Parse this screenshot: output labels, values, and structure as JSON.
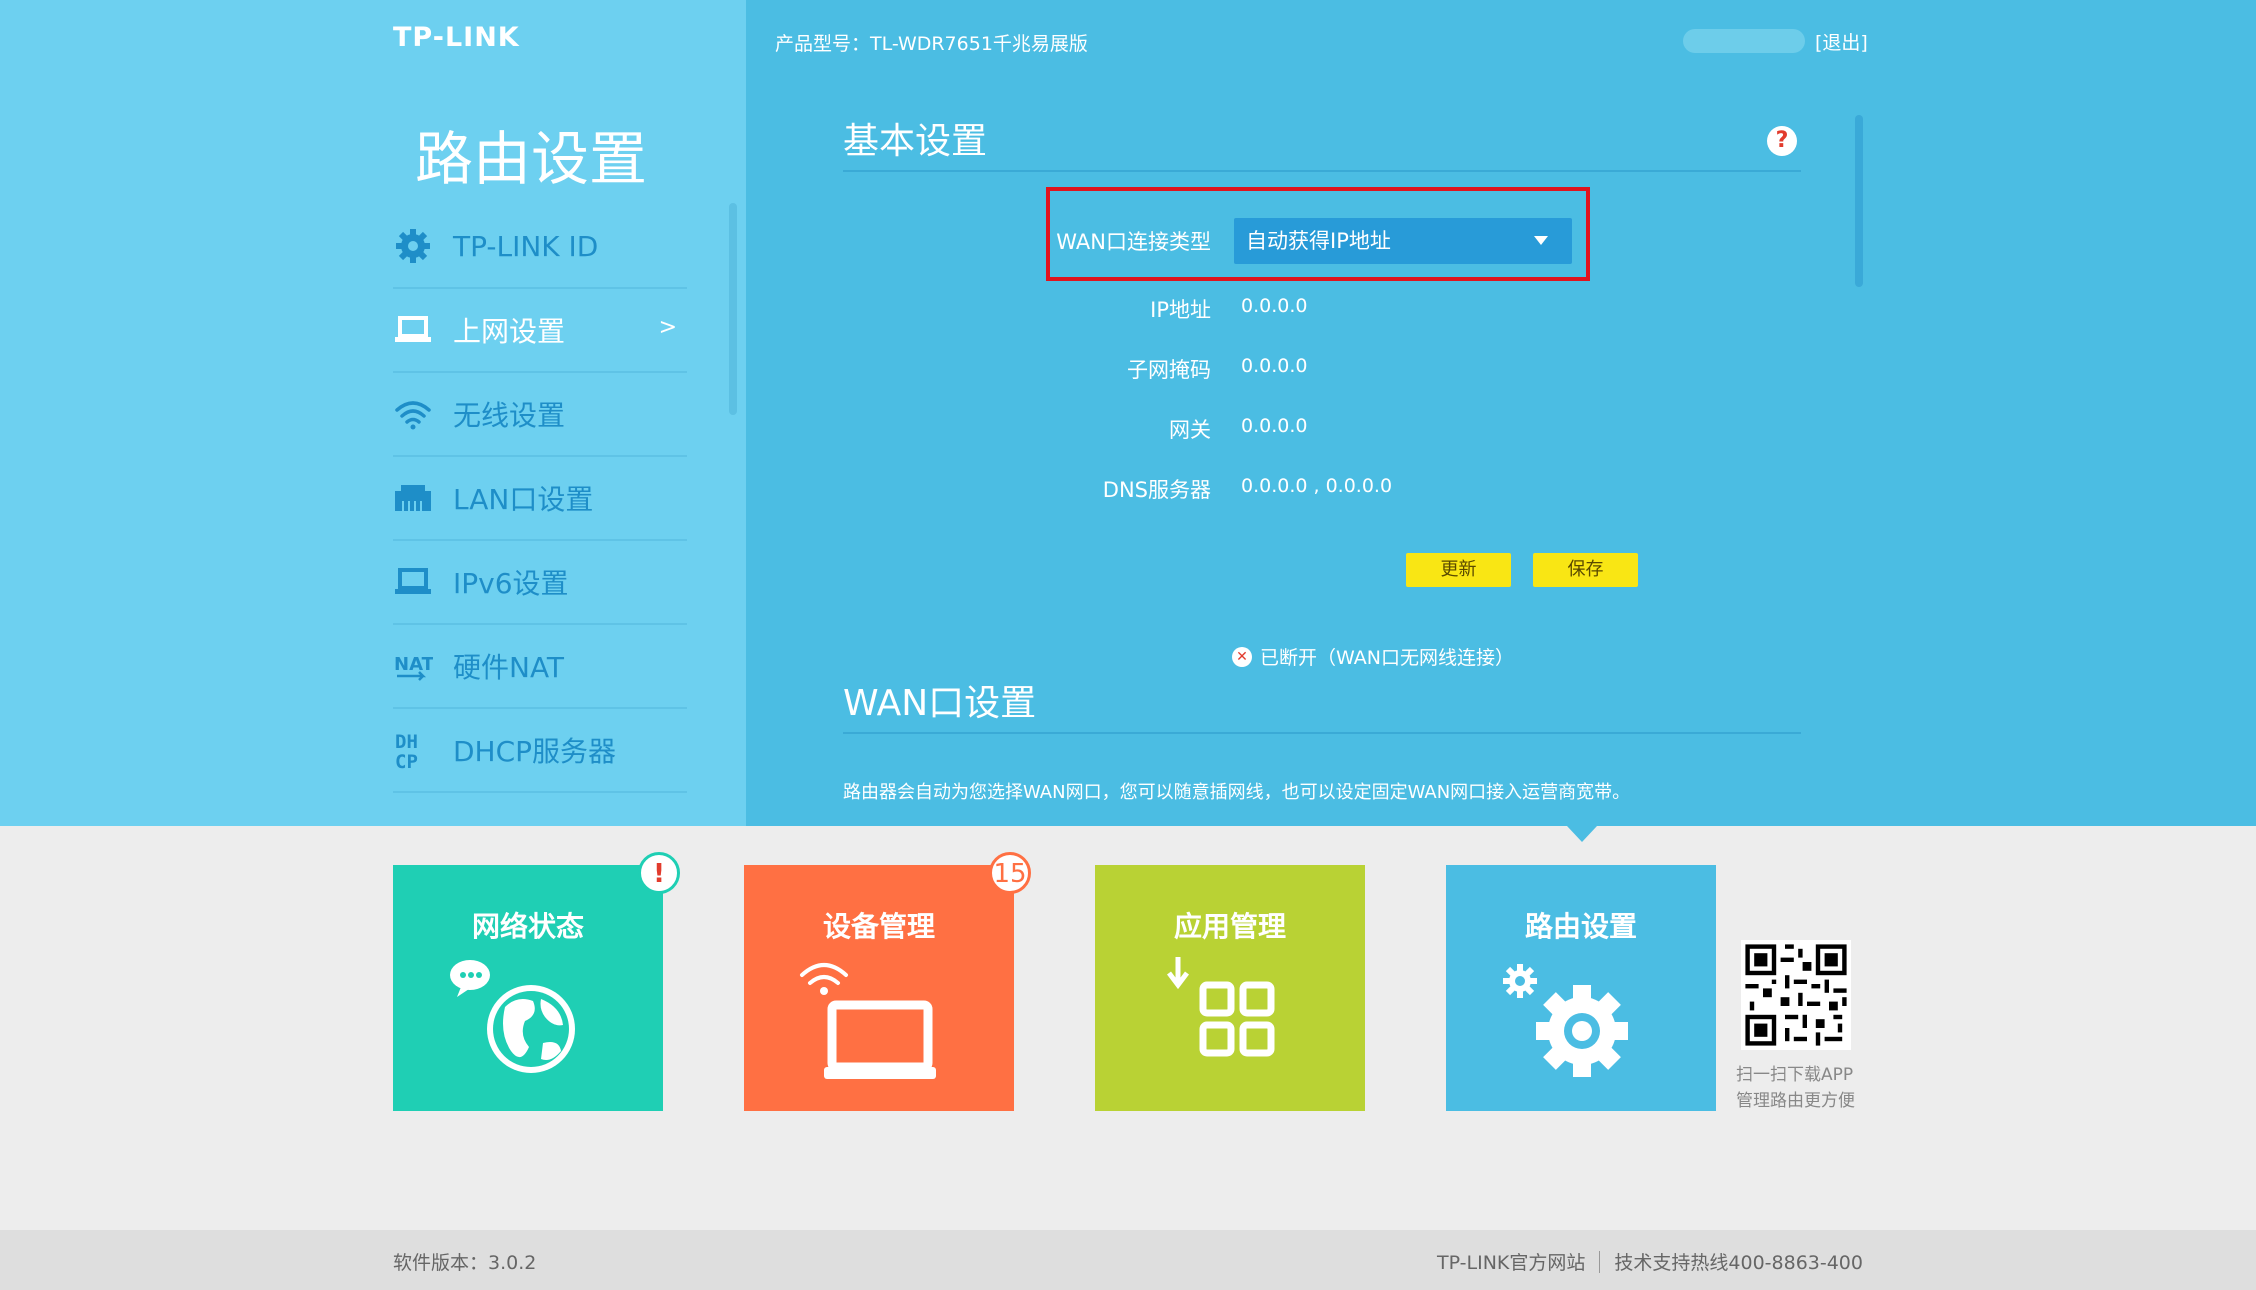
{
  "brand": {
    "logo": "TP-LINK"
  },
  "sidebar": {
    "title": "路由设置",
    "items": [
      {
        "label": "TP-LINK ID",
        "icon": "gear-icon"
      },
      {
        "label": "上网设置",
        "icon": "laptop-icon",
        "active": true,
        "arrow": ">"
      },
      {
        "label": "无线设置",
        "icon": "wifi-icon"
      },
      {
        "label": "LAN口设置",
        "icon": "lan-port-icon"
      },
      {
        "label": "IPv6设置",
        "icon": "laptop-icon"
      },
      {
        "label": "硬件NAT",
        "icon": "nat-icon"
      },
      {
        "label": "DHCP服务器",
        "icon": "dhcp-icon"
      }
    ]
  },
  "header": {
    "model": "产品型号：TL-WDR7651千兆易展版",
    "logout": "[退出]"
  },
  "basic": {
    "title": "基本设置",
    "help": "?",
    "wan_type_label": "WAN口连接类型",
    "wan_type_value": "自动获得IP地址",
    "fields": [
      {
        "label": "IP地址",
        "value": "0.0.0.0"
      },
      {
        "label": "子网掩码",
        "value": "0.0.0.0"
      },
      {
        "label": "网关",
        "value": "0.0.0.0"
      },
      {
        "label": "DNS服务器",
        "value": "0.0.0.0 , 0.0.0.0"
      }
    ],
    "refresh": "更新",
    "save": "保存",
    "status": "已断开（WAN口无网线连接）"
  },
  "wan": {
    "title": "WAN口设置",
    "desc": "路由器会自动为您选择WAN网口，您可以随意插网线，也可以设定固定WAN网口接入运营商宽带。"
  },
  "tiles": [
    {
      "label": "网络状态",
      "color": "#1fcfb4",
      "badge": "!"
    },
    {
      "label": "设备管理",
      "color": "#ff7043",
      "badge": "15"
    },
    {
      "label": "应用管理",
      "color": "#b9d234",
      "badge": ""
    },
    {
      "label": "路由设置",
      "color": "#4bbde3",
      "badge": ""
    }
  ],
  "qr": {
    "line1": "扫一扫下载APP",
    "line2": "管理路由更方便"
  },
  "footer": {
    "version": "软件版本：3.0.2",
    "site": "TP-LINK官方网站",
    "hotline": "技术支持热线400-8863-400"
  }
}
